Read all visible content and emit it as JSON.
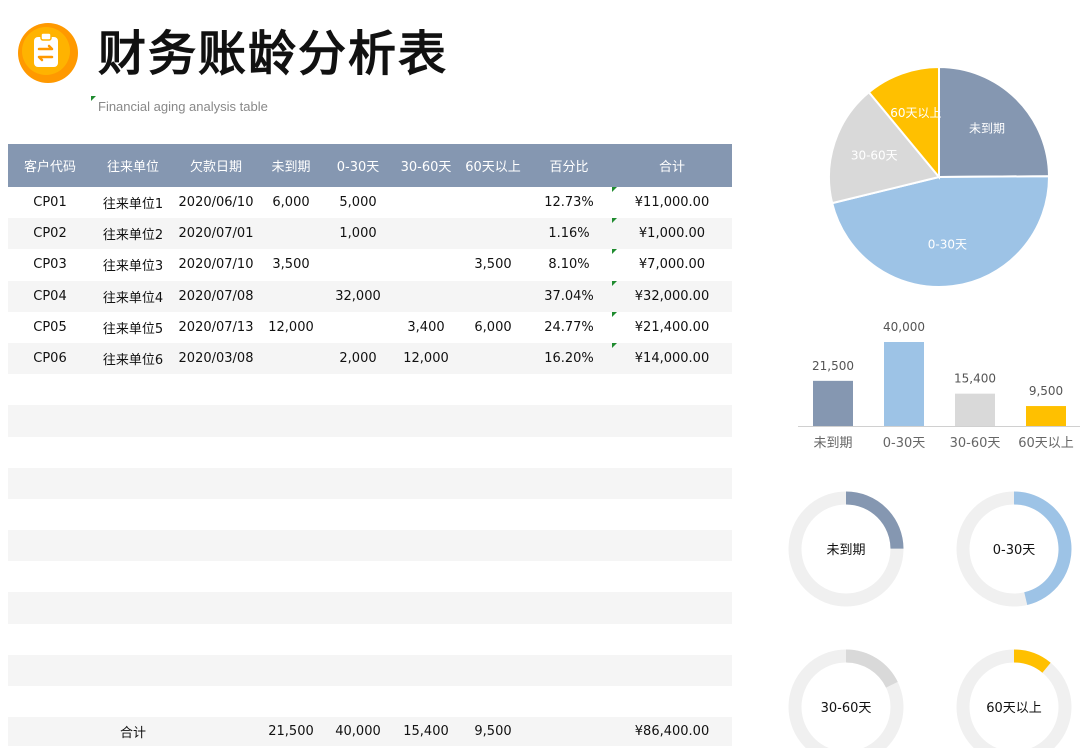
{
  "header": {
    "title": "财务账龄分析表",
    "subtitle": "Financial aging analysis table"
  },
  "colors": {
    "header_bg": "#8597b1",
    "stripe": "#f5f5f5",
    "series": [
      "#8597b1",
      "#9dc3e6",
      "#d9d9d9",
      "#ffc000"
    ],
    "logo_outer": "#ff9900",
    "logo_inner": "#ffb300",
    "flag": "#1f8b2f"
  },
  "icons": {
    "logo": "clipboard-transfer-icon"
  },
  "table": {
    "columns": [
      "客户代码",
      "往来单位",
      "欠款日期",
      "未到期",
      "0-30天",
      "30-60天",
      "60天以上",
      "百分比",
      "合计"
    ],
    "rows": [
      [
        "CP01",
        "往来单位1",
        "2020/06/10",
        "6,000",
        "5,000",
        "",
        "",
        "12.73%",
        "¥11,000.00"
      ],
      [
        "CP02",
        "往来单位2",
        "2020/07/01",
        "",
        "1,000",
        "",
        "",
        "1.16%",
        "¥1,000.00"
      ],
      [
        "CP03",
        "往来单位3",
        "2020/07/10",
        "3,500",
        "",
        "",
        "3,500",
        "8.10%",
        "¥7,000.00"
      ],
      [
        "CP04",
        "往来单位4",
        "2020/07/08",
        "",
        "32,000",
        "",
        "",
        "37.04%",
        "¥32,000.00"
      ],
      [
        "CP05",
        "往来单位5",
        "2020/07/13",
        "12,000",
        "",
        "3,400",
        "6,000",
        "24.77%",
        "¥21,400.00"
      ],
      [
        "CP06",
        "往来单位6",
        "2020/03/08",
        "",
        "2,000",
        "12,000",
        "",
        "16.20%",
        "¥14,000.00"
      ],
      [
        "",
        "",
        "",
        "",
        "",
        "",
        "",
        "",
        ""
      ],
      [
        "",
        "",
        "",
        "",
        "",
        "",
        "",
        "",
        ""
      ],
      [
        "",
        "",
        "",
        "",
        "",
        "",
        "",
        "",
        ""
      ],
      [
        "",
        "",
        "",
        "",
        "",
        "",
        "",
        "",
        ""
      ],
      [
        "",
        "",
        "",
        "",
        "",
        "",
        "",
        "",
        ""
      ],
      [
        "",
        "",
        "",
        "",
        "",
        "",
        "",
        "",
        ""
      ],
      [
        "",
        "",
        "",
        "",
        "",
        "",
        "",
        "",
        ""
      ],
      [
        "",
        "",
        "",
        "",
        "",
        "",
        "",
        "",
        ""
      ],
      [
        "",
        "",
        "",
        "",
        "",
        "",
        "",
        "",
        ""
      ],
      [
        "",
        "",
        "",
        "",
        "",
        "",
        "",
        "",
        ""
      ],
      [
        "",
        "",
        "",
        "",
        "",
        "",
        "",
        "",
        ""
      ]
    ],
    "total_row": [
      "",
      "合计",
      "",
      "21,500",
      "40,000",
      "15,400",
      "9,500",
      "",
      "¥86,400.00"
    ]
  },
  "chart_data": [
    {
      "type": "pie",
      "categories": [
        "未到期",
        "0-30天",
        "30-60天",
        "60天以上"
      ],
      "values": [
        21500,
        40000,
        15400,
        9500
      ],
      "slice_labels": [
        "未到期",
        "0-30天",
        "30-60天",
        "60天以上"
      ]
    },
    {
      "type": "bar",
      "categories": [
        "未到期",
        "0-30天",
        "30-60天",
        "60天以上"
      ],
      "values": [
        21500,
        40000,
        15400,
        9500
      ],
      "data_labels": [
        "21,500",
        "40,000",
        "15,400",
        "9,500"
      ],
      "ylim": [
        0,
        40000
      ],
      "grid": false
    },
    {
      "type": "pie",
      "variant": "donut",
      "label": "未到期",
      "value": 0.2488
    },
    {
      "type": "pie",
      "variant": "donut",
      "label": "0-30天",
      "value": 0.463
    },
    {
      "type": "pie",
      "variant": "donut",
      "label": "30-60天",
      "value": 0.1782
    },
    {
      "type": "pie",
      "variant": "donut",
      "label": "60天以上",
      "value": 0.11
    }
  ]
}
